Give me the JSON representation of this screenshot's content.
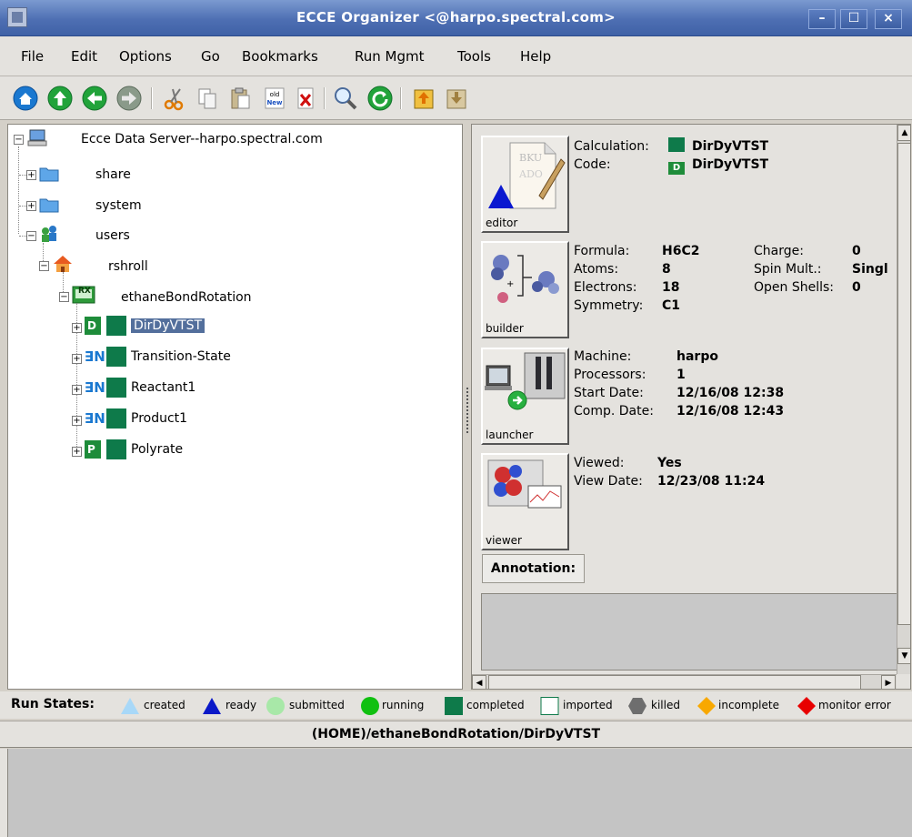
{
  "window": {
    "title": "ECCE Organizer <@harpo.spectral.com>"
  },
  "menu": [
    "File",
    "Edit",
    "Options",
    "Go",
    "Bookmarks",
    "Run Mgmt",
    "Tools",
    "Help"
  ],
  "toolbar": {
    "icons": [
      "home-icon",
      "up-icon",
      "back-icon",
      "forward-icon",
      "cut-icon",
      "copy-icon",
      "paste-icon",
      "old-new-icon",
      "delete-icon",
      "search-icon",
      "refresh-icon",
      "import-icon",
      "export-icon"
    ],
    "old_new_text": "old\nNew"
  },
  "tree": {
    "root": "Ecce Data Server--harpo.spectral.com",
    "share": "share",
    "system": "system",
    "users": "users",
    "rshroll": "rshroll",
    "project": "ethaneBondRotation",
    "project_badge": "RX",
    "calcs": [
      {
        "label": "DirDyVTST",
        "badge": "D"
      },
      {
        "label": "Transition-State",
        "badge": "N"
      },
      {
        "label": "Reactant1",
        "badge": "N"
      },
      {
        "label": "Product1",
        "badge": "N"
      },
      {
        "label": "Polyrate",
        "badge": "P"
      }
    ]
  },
  "details": {
    "editor": {
      "label": "editor",
      "calculation_key": "Calculation:",
      "calculation_val": "DirDyVTST",
      "code_key": "Code:",
      "code_val": "DirDyVTST"
    },
    "builder": {
      "label": "builder",
      "formula_key": "Formula:",
      "formula_val": "H6C2",
      "atoms_key": "Atoms:",
      "atoms_val": "8",
      "electrons_key": "Electrons:",
      "electrons_val": "18",
      "symmetry_key": "Symmetry:",
      "symmetry_val": "C1",
      "charge_key": "Charge:",
      "charge_val": "0",
      "spin_key": "Spin Mult.:",
      "spin_val": "Singl",
      "open_key": "Open Shells:",
      "open_val": "0"
    },
    "launcher": {
      "label": "launcher",
      "machine_key": "Machine:",
      "machine_val": "harpo",
      "processors_key": "Processors:",
      "processors_val": "1",
      "start_key": "Start Date:",
      "start_val": "12/16/08 12:38",
      "comp_key": "Comp. Date:",
      "comp_val": "12/16/08 12:43"
    },
    "viewer": {
      "label": "viewer",
      "viewed_key": "Viewed:",
      "viewed_val": "Yes",
      "viewdate_key": "View Date:",
      "viewdate_val": "12/23/08 11:24"
    },
    "annotation_label": "Annotation:"
  },
  "run_states": {
    "title": "Run States:",
    "items": [
      {
        "label": "created",
        "color": "#a8d8f8",
        "shape": "triangle"
      },
      {
        "label": "ready",
        "color": "#0a18c8",
        "shape": "triangle"
      },
      {
        "label": "submitted",
        "color": "#a8e8a8",
        "shape": "circle"
      },
      {
        "label": "running",
        "color": "#10c010",
        "shape": "circle"
      },
      {
        "label": "completed",
        "color": "#0e7a4a",
        "shape": "square"
      },
      {
        "label": "imported",
        "color": "#ffffff",
        "shape": "square-outline"
      },
      {
        "label": "killed",
        "color": "#6e6e6e",
        "shape": "hexagon"
      },
      {
        "label": "incomplete",
        "color": "#f8a800",
        "shape": "diamond"
      },
      {
        "label": "monitor error",
        "color": "#e80000",
        "shape": "diamond"
      }
    ]
  },
  "path": "(HOME)/ethaneBondRotation/DirDyVTST"
}
